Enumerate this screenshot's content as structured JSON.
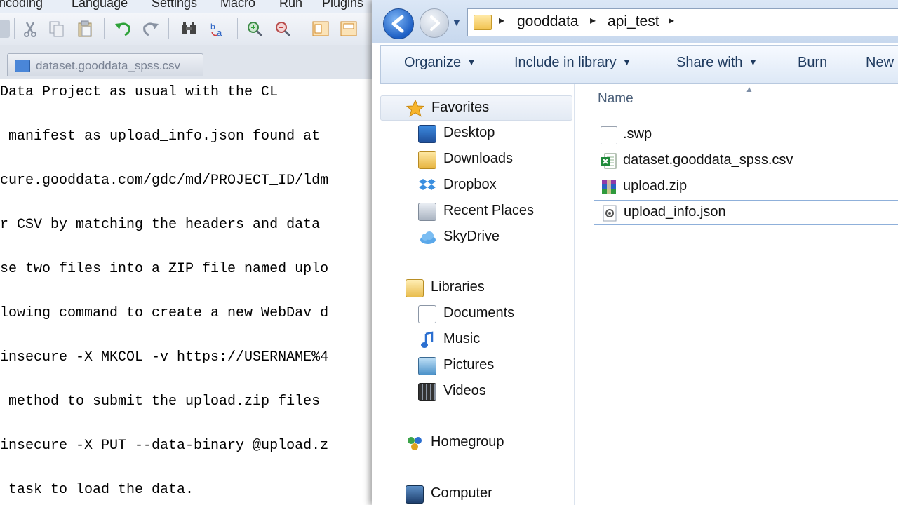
{
  "npp": {
    "menu": [
      "ncoding",
      "Language",
      "Settings",
      "Macro",
      "Run",
      "Plugins"
    ],
    "tab_label": "dataset.gooddata_spss.csv",
    "code_lines": [
      "Data Project as usual with the CL",
      " manifest as upload_info.json found at",
      "cure.gooddata.com/gdc/md/PROJECT_ID/ldm",
      "r CSV by matching the headers and data",
      "se two files into a ZIP file named uplo",
      "lowing command to create a new WebDav d",
      "insecure -X MKCOL -v https://USERNAME%4",
      " method to submit the upload.zip files",
      "insecure -X PUT --data-binary @upload.z",
      " task to load the data."
    ]
  },
  "explorer": {
    "breadcrumb": [
      "gooddata",
      "api_test"
    ],
    "commands": [
      "Organize",
      "Include in library",
      "Share with",
      "Burn",
      "New"
    ],
    "nav": {
      "favorites": "Favorites",
      "favorites_items": [
        "Desktop",
        "Downloads",
        "Dropbox",
        "Recent Places",
        "SkyDrive"
      ],
      "libraries": "Libraries",
      "libraries_items": [
        "Documents",
        "Music",
        "Pictures",
        "Videos"
      ],
      "homegroup": "Homegroup",
      "computer": "Computer"
    },
    "column_name": "Name",
    "files": [
      ".swp",
      "dataset.gooddata_spss.csv",
      "upload.zip",
      "upload_info.json"
    ]
  },
  "colors": {
    "accent_blue": "#1d5fc4",
    "nav_bg": "#f3f6fb",
    "text_dark": "#111111"
  }
}
